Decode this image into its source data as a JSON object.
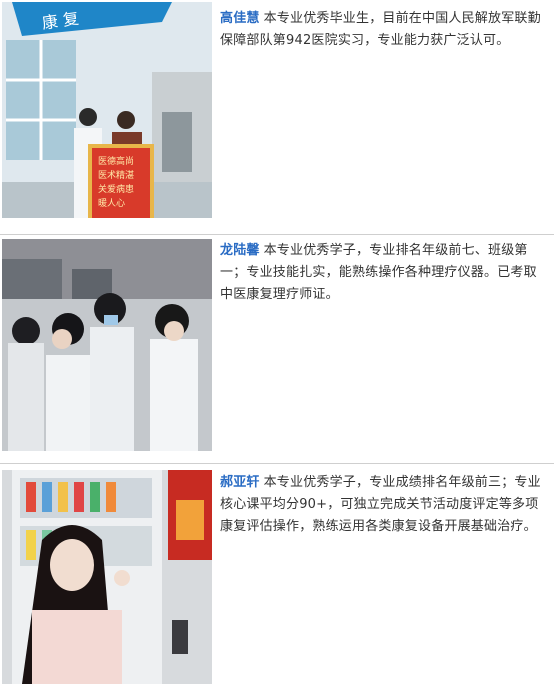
{
  "students": [
    {
      "name": "高佳慧",
      "description": "本专业优秀毕业生，目前在中国人民解放军联勤保障部队第942医院实习，专业能力获广泛认可。",
      "photo_label": "graduate-with-banner-photo"
    },
    {
      "name": "龙陆馨",
      "description": "本专业优秀学子，专业排名年级前七、班级第一；专业技能扎实，能熟练操作各种理疗仪器。已考取中医康复理疗师证。",
      "photo_label": "students-in-lab-coats-photo"
    },
    {
      "name": "郝亚轩",
      "description": "本专业优秀学子，专业成绩排名年级前三；专业核心课平均分90+，可独立完成关节活动度评定等多项康复评估操作，熟练运用各类康复设备开展基础治疗。",
      "photo_label": "student-by-vending-machine-photo"
    }
  ],
  "banner_text": "康 复",
  "banner_lines": [
    "医德高尚",
    "医术精湛",
    "关爱病患",
    "暖人心"
  ],
  "accent_color": "#2a6cc4"
}
